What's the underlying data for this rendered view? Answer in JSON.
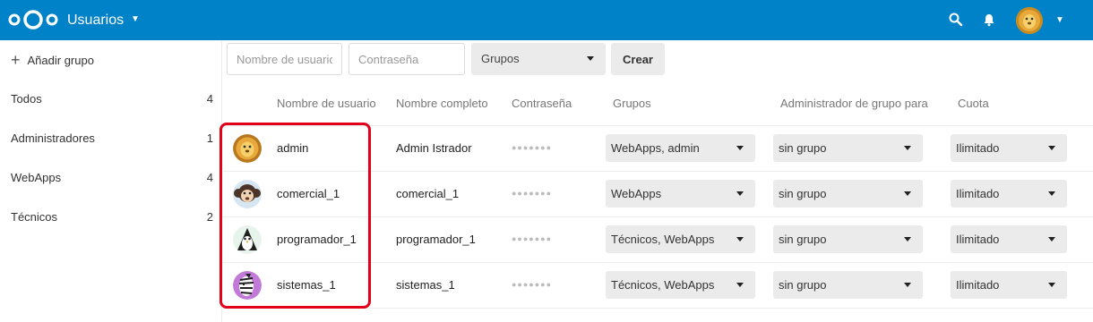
{
  "header": {
    "app_title": "Usuarios"
  },
  "sidebar": {
    "add_group_label": "Añadir grupo",
    "groups": [
      {
        "label": "Todos",
        "count": "4"
      },
      {
        "label": "Administradores",
        "count": "1"
      },
      {
        "label": "WebApps",
        "count": "4"
      },
      {
        "label": "Técnicos",
        "count": "2"
      }
    ]
  },
  "create": {
    "username_placeholder": "Nombre de usuario",
    "password_placeholder": "Contraseña",
    "groups_label": "Grupos",
    "create_button": "Crear"
  },
  "table": {
    "headers": {
      "username": "Nombre de usuario",
      "fullname": "Nombre completo",
      "password": "Contraseña",
      "groups": "Grupos",
      "group_admin": "Administrador de grupo para",
      "quota": "Cuota"
    },
    "rows": [
      {
        "username": "admin",
        "fullname": "Admin Istrador",
        "password": "●●●●●●●",
        "groups": "WebApps, admin",
        "group_admin": "sin grupo",
        "quota": "Ilimitado",
        "avatar_icon": "lion-avatar-icon"
      },
      {
        "username": "comercial_1",
        "fullname": "comercial_1",
        "password": "●●●●●●●",
        "groups": "WebApps",
        "group_admin": "sin grupo",
        "quota": "Ilimitado",
        "avatar_icon": "monkey-avatar-icon"
      },
      {
        "username": "programador_1",
        "fullname": "programador_1",
        "password": "●●●●●●●",
        "groups": "Técnicos, WebApps",
        "group_admin": "sin grupo",
        "quota": "Ilimitado",
        "avatar_icon": "penguin-avatar-icon"
      },
      {
        "username": "sistemas_1",
        "fullname": "sistemas_1",
        "password": "●●●●●●●",
        "groups": "Técnicos, WebApps",
        "group_admin": "sin grupo",
        "quota": "Ilimitado",
        "avatar_icon": "zebra-avatar-icon"
      }
    ]
  },
  "colors": {
    "header_bg": "#0082c9",
    "highlight": "#e3001b",
    "dropdown_bg": "#ebebeb"
  }
}
